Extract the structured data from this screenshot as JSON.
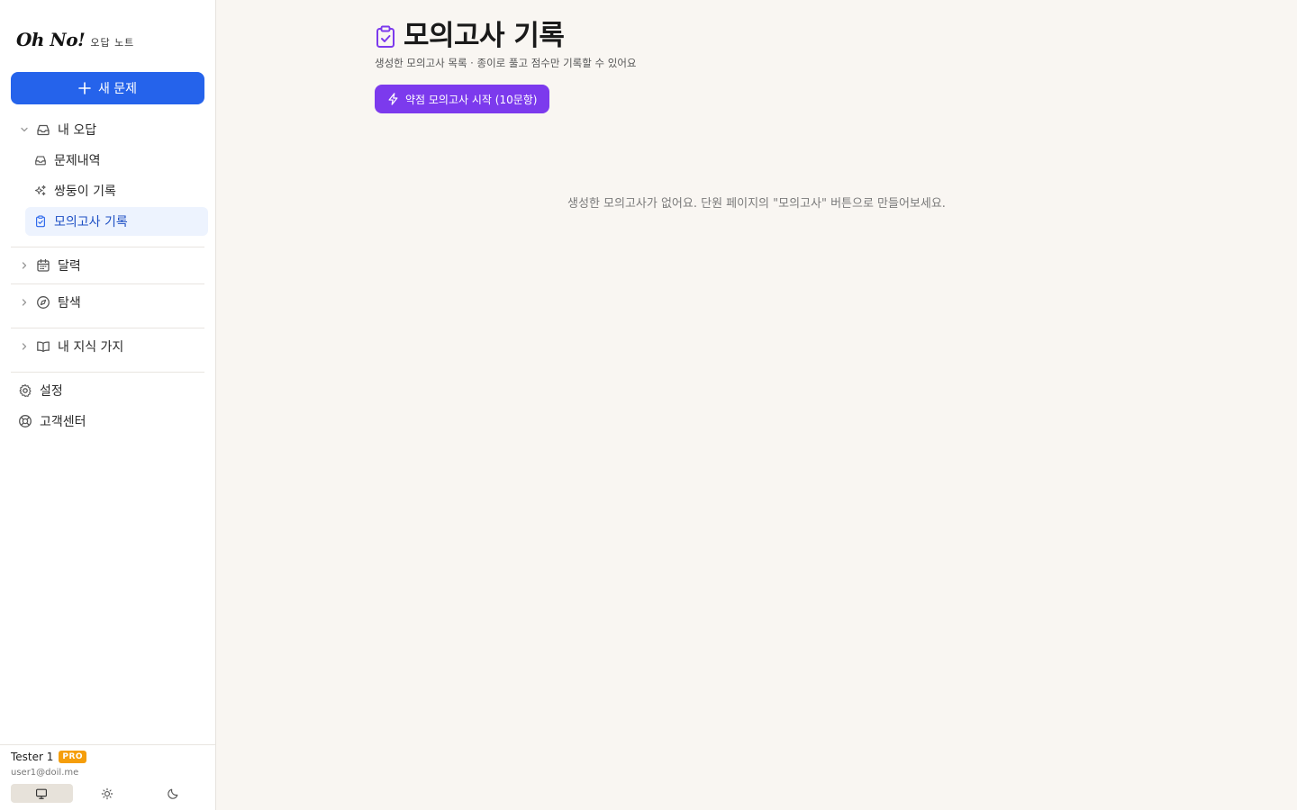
{
  "sidebar": {
    "logo": {
      "main": "Oh No!",
      "sub": "오답 노트"
    },
    "new_button": "새 문제",
    "sections": {
      "my_wrong": {
        "label": "내 오답",
        "expanded": true
      },
      "calendar": {
        "label": "달력"
      },
      "explore": {
        "label": "탐색"
      },
      "knowledge": {
        "label": "내 지식 가지"
      }
    },
    "sub_items": {
      "history": "문제내역",
      "twins": "쌍둥이 기록",
      "mock_exam": "모의고사 기록"
    },
    "settings": "설정",
    "support": "고객센터",
    "user": {
      "name": "Tester 1",
      "badge": "PRO",
      "email": "user1@doil.me"
    },
    "theme": {
      "options": [
        "system",
        "light",
        "dark"
      ],
      "selected": "system"
    }
  },
  "main": {
    "title": "모의고사 기록",
    "subtitle": "생성한 모의고사 목록 · 종이로 풀고 점수만 기록할 수 있어요",
    "start_button": "약점 모의고사 시작 (10문항)",
    "empty_message": "생성한 모의고사가 없어요. 단원 페이지의 \"모의고사\" 버튼으로 만들어보세요."
  },
  "colors": {
    "primary": "#2563eb",
    "accent_purple": "#7c3aed",
    "active_bg": "#edf3fe",
    "pro_badge": "#f59e0b",
    "main_bg": "#f9f6f2"
  },
  "icons": {
    "new": "plus-icon",
    "my_wrong": "inbox-icon",
    "history": "inbox-icon",
    "twins": "sparkles-icon",
    "mock_exam": "clipboard-check-icon",
    "calendar": "calendar-icon",
    "explore": "compass-icon",
    "knowledge": "book-open-icon",
    "settings": "gear-icon",
    "support": "lifebuoy-icon",
    "start": "lightning-icon"
  }
}
